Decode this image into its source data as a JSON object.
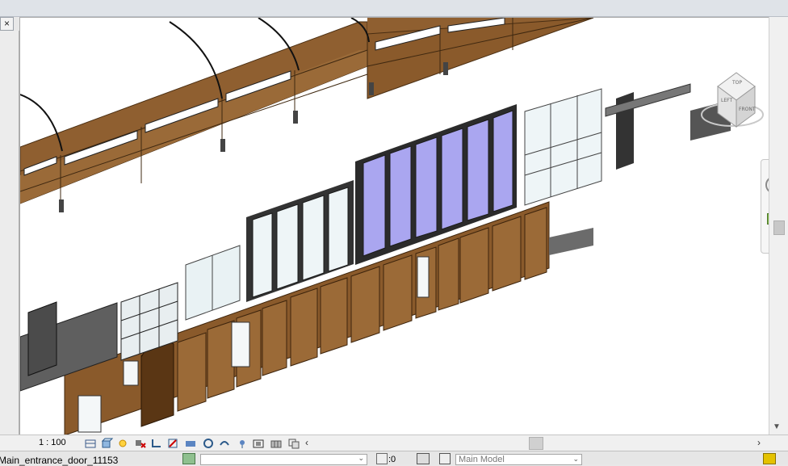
{
  "tab": {
    "close_glyph": "×"
  },
  "status": {
    "scale": "1 : 100",
    "selection": "Main_entrance_door_11153",
    "filter_count": ":0",
    "model": "Main Model"
  },
  "viewcube": {
    "top": "TOP",
    "front": "FRONT",
    "left": "LEFT"
  },
  "view_control_icons": [
    "detail-level-icon",
    "visual-style-icon",
    "sun-path-icon",
    "shadows-icon",
    "crop-view-icon",
    "show-crop-icon",
    "temporary-hide-icon",
    "reveal-hidden-icon",
    "lock-3d-icon",
    "analytical-model-icon",
    "highlight-displacement-icon",
    "render-icon",
    "worksharing-icon",
    "design-options-icon"
  ],
  "colors": {
    "wood": "#8a5a2b",
    "wood_dark": "#5e3a17",
    "frame": "#3a3a3a",
    "glass": "#e9f2f4",
    "glass_tint": "#a9a6f2",
    "metal": "#6b6b6b"
  }
}
